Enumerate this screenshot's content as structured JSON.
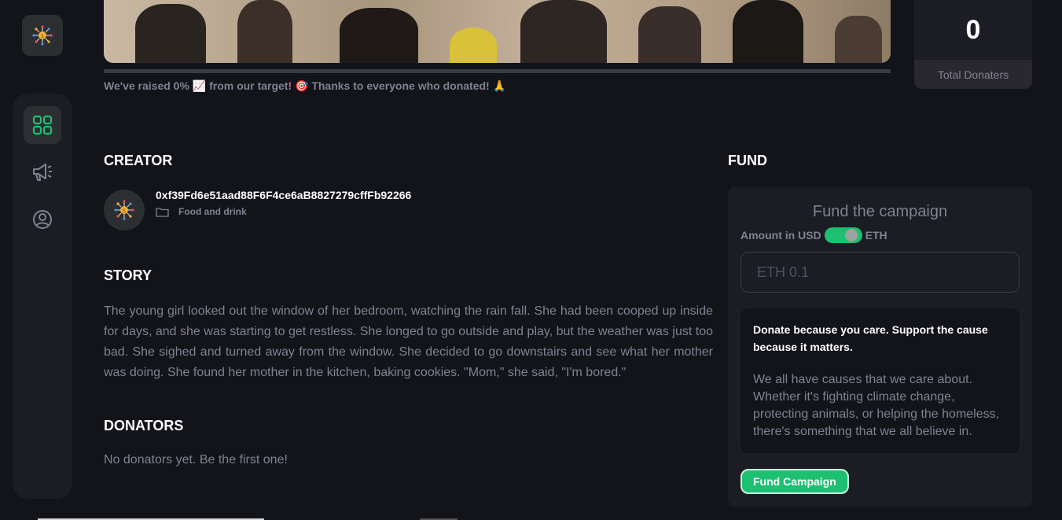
{
  "sidebar": {
    "logo_icon": "crowdfund-logo-icon",
    "items": [
      {
        "icon": "dashboard-grid-icon",
        "active": true
      },
      {
        "icon": "megaphone-icon",
        "active": false
      },
      {
        "icon": "profile-icon",
        "active": false
      }
    ]
  },
  "campaign": {
    "raised_message": "We've raised 0% 📈 from our target! 🎯 Thanks to everyone who donated! 🙏",
    "progress_fraction": 0,
    "stats": {
      "total_donaters_value": "0",
      "total_donaters_label": "Total Donaters"
    }
  },
  "creator": {
    "title": "CREATOR",
    "address": "0xf39Fd6e51aad88F6F4ce6aB8827279cffFb92266",
    "category": "Food and drink"
  },
  "story": {
    "title": "STORY",
    "text": "The young girl looked out the window of her bedroom, watching the rain fall. She had been cooped up inside for days, and she was starting to get restless. She longed to go outside and play, but the weather was just too bad. She sighed and turned away from the window. She decided to go downstairs and see what her mother was doing. She found her mother in the kitchen, baking cookies. \"Mom,\" she said, \"I'm bored.\""
  },
  "donators": {
    "title": "DONATORS",
    "empty_text": "No donators yet. Be the first one!"
  },
  "fund": {
    "title": "FUND",
    "heading": "Fund the campaign",
    "toggle_left": "Amount in USD",
    "toggle_right": "ETH",
    "amount_placeholder": "ETH 0.1",
    "info_bold": "Donate because you care. Support the cause because it matters.",
    "info_text": "We all have causes that we care about. Whether it's fighting climate change, protecting animals, or helping the homeless, there's something that we all believe in.",
    "button_label": "Fund Campaign"
  },
  "colors": {
    "accent": "#1dc071",
    "progress": "#4acd8d",
    "muted": "#808191",
    "card": "#1c1c24",
    "bg": "#13131a"
  }
}
